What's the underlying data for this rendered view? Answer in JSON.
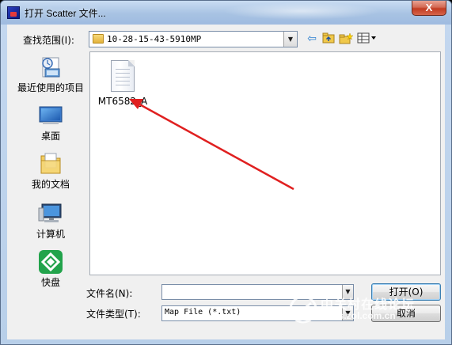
{
  "window": {
    "title": "打开 Scatter 文件...",
    "close_label": "X"
  },
  "lookin": {
    "label": "查找范围(I):",
    "folder": "10-28-15-43-5910MP"
  },
  "toolbar": {
    "icons": [
      "back-icon",
      "up-folder-icon",
      "new-folder-icon",
      "view-menu-icon"
    ]
  },
  "places": [
    {
      "label": "最近使用的项目",
      "icon": "recent-items-icon"
    },
    {
      "label": "桌面",
      "icon": "desktop-icon"
    },
    {
      "label": "我的文档",
      "icon": "documents-icon"
    },
    {
      "label": "计算机",
      "icon": "computer-icon"
    },
    {
      "label": "快盘",
      "icon": "kuaipan-icon"
    }
  ],
  "files": [
    {
      "name": "MT6582_A"
    }
  ],
  "filename": {
    "label": "文件名(N):",
    "value": ""
  },
  "filetype": {
    "label": "文件类型(T):",
    "value": "Map File (*.txt)"
  },
  "buttons": {
    "open": "打开(O)",
    "cancel": "取消"
  },
  "watermark": {
    "brand": "中关村在线论坛",
    "url": "bbs.zol.com.cn"
  },
  "colors": {
    "annotation_arrow": "#e02020",
    "close_button": "#c23b22"
  }
}
